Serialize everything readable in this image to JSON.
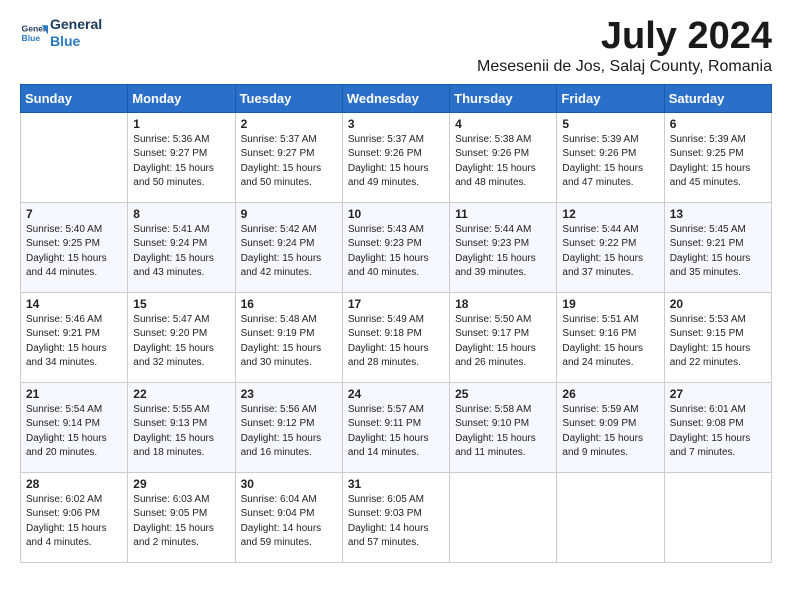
{
  "header": {
    "logo_line1": "General",
    "logo_line2": "Blue",
    "month": "July 2024",
    "location": "Mesesenii de Jos, Salaj County, Romania"
  },
  "weekdays": [
    "Sunday",
    "Monday",
    "Tuesday",
    "Wednesday",
    "Thursday",
    "Friday",
    "Saturday"
  ],
  "weeks": [
    [
      {
        "day": "",
        "text": ""
      },
      {
        "day": "1",
        "text": "Sunrise: 5:36 AM\nSunset: 9:27 PM\nDaylight: 15 hours\nand 50 minutes."
      },
      {
        "day": "2",
        "text": "Sunrise: 5:37 AM\nSunset: 9:27 PM\nDaylight: 15 hours\nand 50 minutes."
      },
      {
        "day": "3",
        "text": "Sunrise: 5:37 AM\nSunset: 9:26 PM\nDaylight: 15 hours\nand 49 minutes."
      },
      {
        "day": "4",
        "text": "Sunrise: 5:38 AM\nSunset: 9:26 PM\nDaylight: 15 hours\nand 48 minutes."
      },
      {
        "day": "5",
        "text": "Sunrise: 5:39 AM\nSunset: 9:26 PM\nDaylight: 15 hours\nand 47 minutes."
      },
      {
        "day": "6",
        "text": "Sunrise: 5:39 AM\nSunset: 9:25 PM\nDaylight: 15 hours\nand 45 minutes."
      }
    ],
    [
      {
        "day": "7",
        "text": "Sunrise: 5:40 AM\nSunset: 9:25 PM\nDaylight: 15 hours\nand 44 minutes."
      },
      {
        "day": "8",
        "text": "Sunrise: 5:41 AM\nSunset: 9:24 PM\nDaylight: 15 hours\nand 43 minutes."
      },
      {
        "day": "9",
        "text": "Sunrise: 5:42 AM\nSunset: 9:24 PM\nDaylight: 15 hours\nand 42 minutes."
      },
      {
        "day": "10",
        "text": "Sunrise: 5:43 AM\nSunset: 9:23 PM\nDaylight: 15 hours\nand 40 minutes."
      },
      {
        "day": "11",
        "text": "Sunrise: 5:44 AM\nSunset: 9:23 PM\nDaylight: 15 hours\nand 39 minutes."
      },
      {
        "day": "12",
        "text": "Sunrise: 5:44 AM\nSunset: 9:22 PM\nDaylight: 15 hours\nand 37 minutes."
      },
      {
        "day": "13",
        "text": "Sunrise: 5:45 AM\nSunset: 9:21 PM\nDaylight: 15 hours\nand 35 minutes."
      }
    ],
    [
      {
        "day": "14",
        "text": "Sunrise: 5:46 AM\nSunset: 9:21 PM\nDaylight: 15 hours\nand 34 minutes."
      },
      {
        "day": "15",
        "text": "Sunrise: 5:47 AM\nSunset: 9:20 PM\nDaylight: 15 hours\nand 32 minutes."
      },
      {
        "day": "16",
        "text": "Sunrise: 5:48 AM\nSunset: 9:19 PM\nDaylight: 15 hours\nand 30 minutes."
      },
      {
        "day": "17",
        "text": "Sunrise: 5:49 AM\nSunset: 9:18 PM\nDaylight: 15 hours\nand 28 minutes."
      },
      {
        "day": "18",
        "text": "Sunrise: 5:50 AM\nSunset: 9:17 PM\nDaylight: 15 hours\nand 26 minutes."
      },
      {
        "day": "19",
        "text": "Sunrise: 5:51 AM\nSunset: 9:16 PM\nDaylight: 15 hours\nand 24 minutes."
      },
      {
        "day": "20",
        "text": "Sunrise: 5:53 AM\nSunset: 9:15 PM\nDaylight: 15 hours\nand 22 minutes."
      }
    ],
    [
      {
        "day": "21",
        "text": "Sunrise: 5:54 AM\nSunset: 9:14 PM\nDaylight: 15 hours\nand 20 minutes."
      },
      {
        "day": "22",
        "text": "Sunrise: 5:55 AM\nSunset: 9:13 PM\nDaylight: 15 hours\nand 18 minutes."
      },
      {
        "day": "23",
        "text": "Sunrise: 5:56 AM\nSunset: 9:12 PM\nDaylight: 15 hours\nand 16 minutes."
      },
      {
        "day": "24",
        "text": "Sunrise: 5:57 AM\nSunset: 9:11 PM\nDaylight: 15 hours\nand 14 minutes."
      },
      {
        "day": "25",
        "text": "Sunrise: 5:58 AM\nSunset: 9:10 PM\nDaylight: 15 hours\nand 11 minutes."
      },
      {
        "day": "26",
        "text": "Sunrise: 5:59 AM\nSunset: 9:09 PM\nDaylight: 15 hours\nand 9 minutes."
      },
      {
        "day": "27",
        "text": "Sunrise: 6:01 AM\nSunset: 9:08 PM\nDaylight: 15 hours\nand 7 minutes."
      }
    ],
    [
      {
        "day": "28",
        "text": "Sunrise: 6:02 AM\nSunset: 9:06 PM\nDaylight: 15 hours\nand 4 minutes."
      },
      {
        "day": "29",
        "text": "Sunrise: 6:03 AM\nSunset: 9:05 PM\nDaylight: 15 hours\nand 2 minutes."
      },
      {
        "day": "30",
        "text": "Sunrise: 6:04 AM\nSunset: 9:04 PM\nDaylight: 14 hours\nand 59 minutes."
      },
      {
        "day": "31",
        "text": "Sunrise: 6:05 AM\nSunset: 9:03 PM\nDaylight: 14 hours\nand 57 minutes."
      },
      {
        "day": "",
        "text": ""
      },
      {
        "day": "",
        "text": ""
      },
      {
        "day": "",
        "text": ""
      }
    ]
  ]
}
